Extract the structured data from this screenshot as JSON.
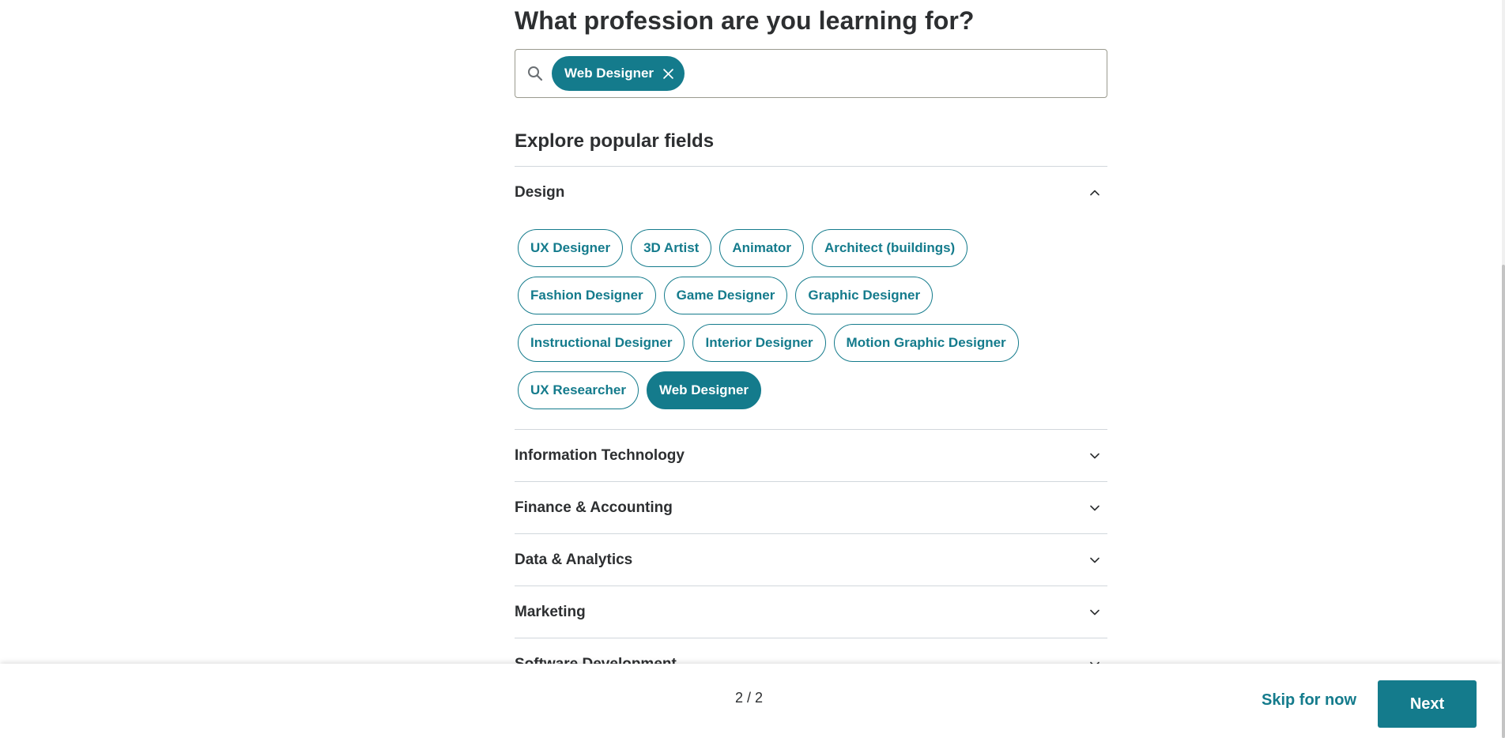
{
  "page": {
    "question": "What profession are you learning for?",
    "explore_title": "Explore popular fields"
  },
  "search": {
    "icon": "search-icon",
    "selected_chip": {
      "label": "Web Designer",
      "icon": "close-icon"
    }
  },
  "accordion": {
    "design": {
      "label": "Design",
      "expanded": true,
      "icon": "chevron-up-icon",
      "roles": [
        "UX Designer",
        "3D Artist",
        "Animator",
        "Architect (buildings)",
        "Fashion Designer",
        "Game Designer",
        "Graphic Designer",
        "Instructional Designer",
        "Interior Designer",
        "Motion Graphic Designer",
        "UX Researcher",
        "Web Designer"
      ],
      "selected_role": "Web Designer"
    },
    "information_technology": {
      "label": "Information Technology",
      "icon": "chevron-down-icon"
    },
    "finance_accounting": {
      "label": "Finance & Accounting",
      "icon": "chevron-down-icon"
    },
    "data_analytics": {
      "label": "Data & Analytics",
      "icon": "chevron-down-icon"
    },
    "marketing": {
      "label": "Marketing",
      "icon": "chevron-down-icon"
    },
    "software_development": {
      "label": "Software Development",
      "icon": "chevron-down-icon"
    }
  },
  "footer": {
    "progress": "2 / 2",
    "skip_label": "Skip for now",
    "next_label": "Next"
  },
  "colors": {
    "accent": "#147b8c",
    "text": "#2d2f31",
    "divider": "#d1d7dc"
  }
}
